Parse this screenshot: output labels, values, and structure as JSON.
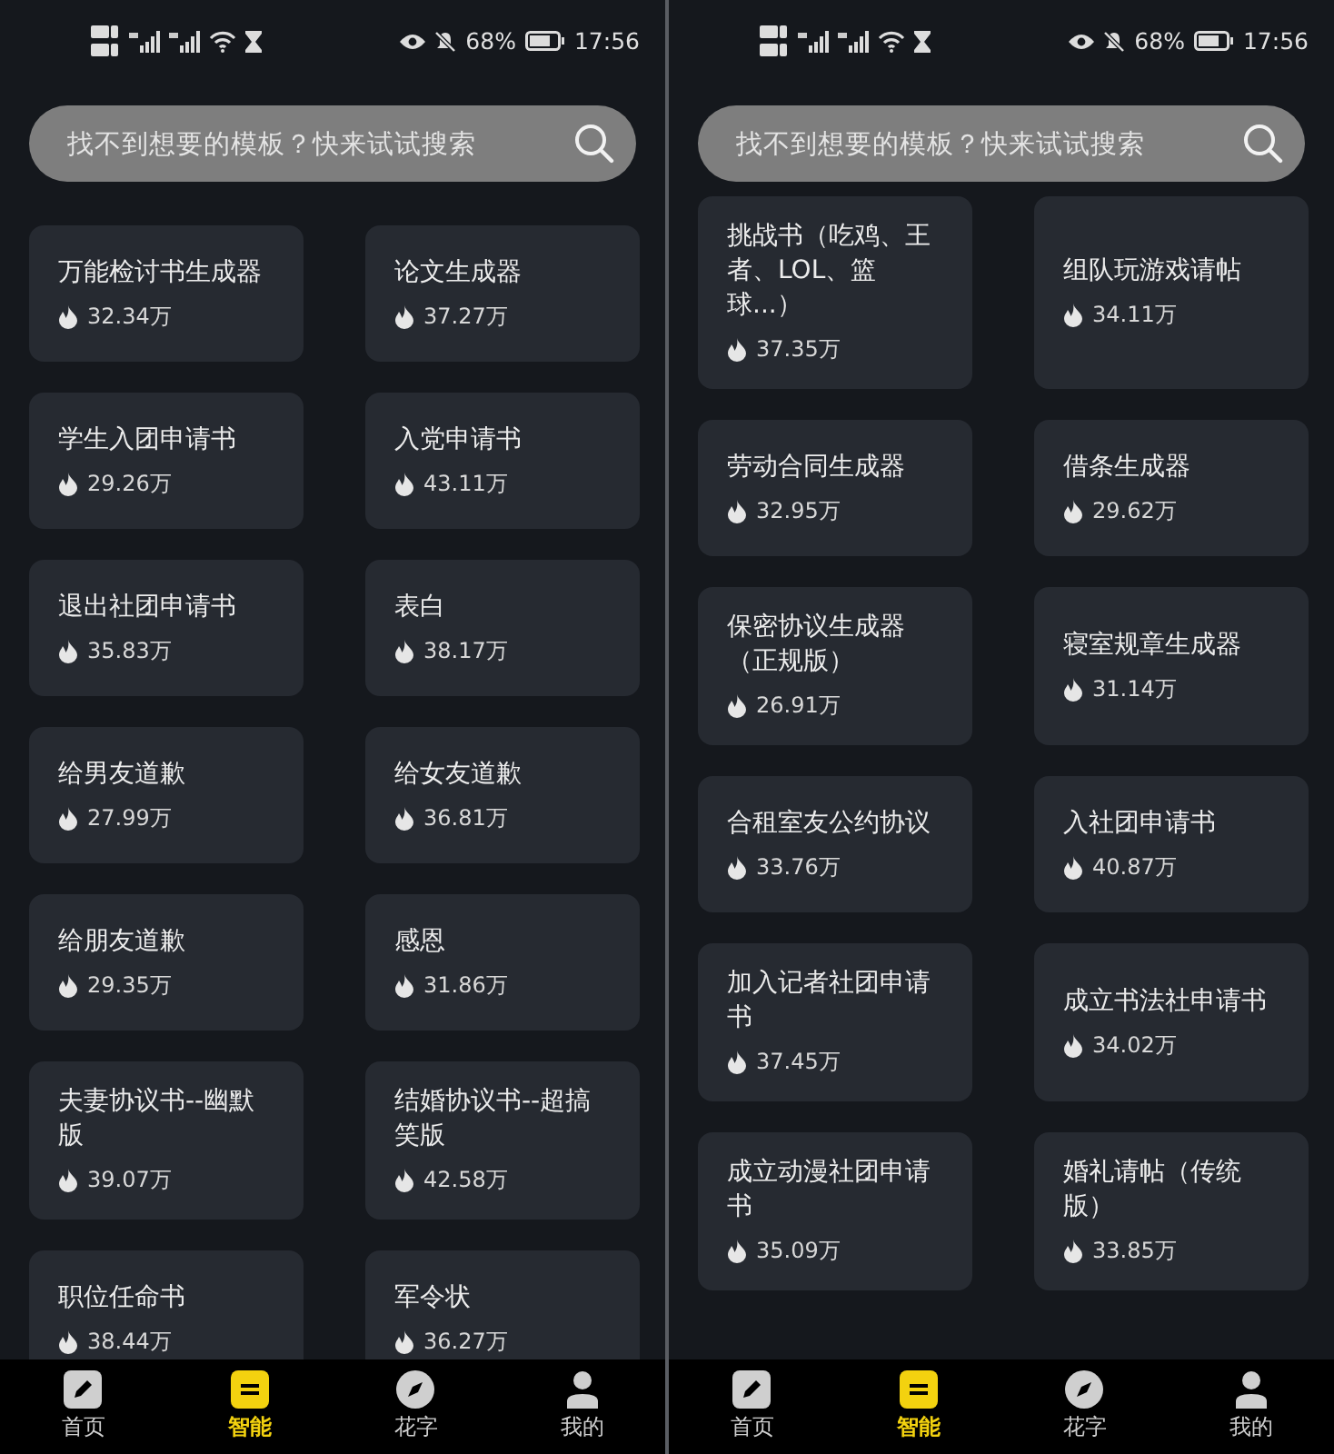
{
  "phones": [
    {
      "status_bar": {
        "battery": "68%",
        "time": "17:56"
      },
      "search": {
        "placeholder": "找不到想要的模板？快来试试搜索"
      },
      "templates": [
        {
          "title": "万能检讨书生成器",
          "count": "32.34万"
        },
        {
          "title": "论文生成器",
          "count": "37.27万"
        },
        {
          "title": "学生入团申请书",
          "count": "29.26万"
        },
        {
          "title": "入党申请书",
          "count": "43.11万"
        },
        {
          "title": "退出社团申请书",
          "count": "35.83万"
        },
        {
          "title": "表白",
          "count": "38.17万"
        },
        {
          "title": "给男友道歉",
          "count": "27.99万"
        },
        {
          "title": "给女友道歉",
          "count": "36.81万"
        },
        {
          "title": "给朋友道歉",
          "count": "29.35万"
        },
        {
          "title": "感恩",
          "count": "31.86万"
        },
        {
          "title": "夫妻协议书--幽默版",
          "count": "39.07万"
        },
        {
          "title": "结婚协议书--超搞笑版",
          "count": "42.58万"
        },
        {
          "title": "职位任命书",
          "count": "38.44万"
        },
        {
          "title": "军令状",
          "count": "36.27万"
        }
      ],
      "nav": [
        {
          "label": "首页",
          "kind": "edit",
          "selected": false
        },
        {
          "label": "智能",
          "kind": "smart",
          "selected": true
        },
        {
          "label": "花字",
          "kind": "compass",
          "selected": false
        },
        {
          "label": "我的",
          "kind": "person",
          "selected": false
        }
      ]
    },
    {
      "status_bar": {
        "battery": "68%",
        "time": "17:56"
      },
      "search": {
        "placeholder": "找不到想要的模板？快来试试搜索"
      },
      "templates": [
        {
          "title": "挑战书（吃鸡、王者、LOL、篮球...）",
          "count": "37.35万"
        },
        {
          "title": "组队玩游戏请帖",
          "count": "34.11万"
        },
        {
          "title": "劳动合同生成器",
          "count": "32.95万"
        },
        {
          "title": "借条生成器",
          "count": "29.62万"
        },
        {
          "title": "保密协议生成器（正规版）",
          "count": "26.91万"
        },
        {
          "title": "寝室规章生成器",
          "count": "31.14万"
        },
        {
          "title": "合租室友公约协议",
          "count": "33.76万"
        },
        {
          "title": "入社团申请书",
          "count": "40.87万"
        },
        {
          "title": "加入记者社团申请书",
          "count": "37.45万"
        },
        {
          "title": "成立书法社申请书",
          "count": "34.02万"
        },
        {
          "title": "成立动漫社团申请书",
          "count": "35.09万"
        },
        {
          "title": "婚礼请帖（传统版）",
          "count": "33.85万"
        }
      ],
      "nav": [
        {
          "label": "首页",
          "kind": "edit",
          "selected": false
        },
        {
          "label": "智能",
          "kind": "smart",
          "selected": true
        },
        {
          "label": "花字",
          "kind": "compass",
          "selected": false
        },
        {
          "label": "我的",
          "kind": "person",
          "selected": false
        }
      ]
    }
  ]
}
